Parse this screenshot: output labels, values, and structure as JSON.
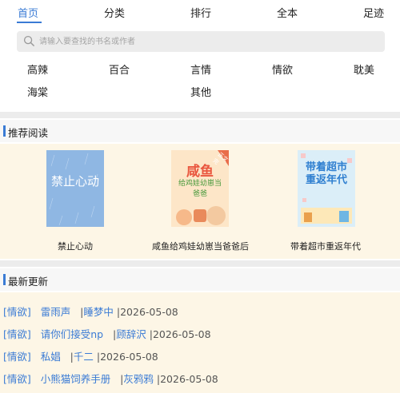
{
  "nav": {
    "tabs": [
      {
        "label": "首页",
        "active": true
      },
      {
        "label": "分类"
      },
      {
        "label": "排行"
      },
      {
        "label": "全本"
      },
      {
        "label": "足迹"
      }
    ]
  },
  "search": {
    "placeholder": "请输入要查找的书名或作者"
  },
  "categories": [
    "高辣",
    "百合",
    "言情",
    "情欲",
    "耽美",
    "海棠",
    "其他"
  ],
  "recommend": {
    "title": "推荐阅读",
    "books": [
      {
        "title": "禁止心动",
        "cover_text": "禁止心动",
        "cover_color": "#8fb7e3"
      },
      {
        "title": "咸鱼给鸡娃幼崽当爸爸后",
        "cover_text": "咸鱼",
        "cover_subtext": "给鸡娃幼崽当爸爸",
        "cover_tag": "正文完",
        "cover_color": "#fde6c8"
      },
      {
        "title": "带着超市重返年代",
        "cover_text": "带着超市重返年代",
        "cover_color": "#dbeef8"
      }
    ]
  },
  "latest": {
    "title": "最新更新",
    "items": [
      {
        "tag": "[情欲]",
        "name": "雷雨声",
        "author": "睡梦中",
        "date": "2026-05-08"
      },
      {
        "tag": "[情欲]",
        "name": "请你们接受np",
        "author": "顾辞沢",
        "date": "2026-05-08"
      },
      {
        "tag": "[情欲]",
        "name": "私娼",
        "author": "千二",
        "date": "2026-05-08"
      },
      {
        "tag": "[情欲]",
        "name": "小熊猫饲养手册",
        "author": "灰鸦鸦",
        "date": "2026-05-08"
      }
    ]
  },
  "colors": {
    "accent": "#3a7bd5",
    "panel": "#fdf6e6",
    "band": "#ececec"
  }
}
